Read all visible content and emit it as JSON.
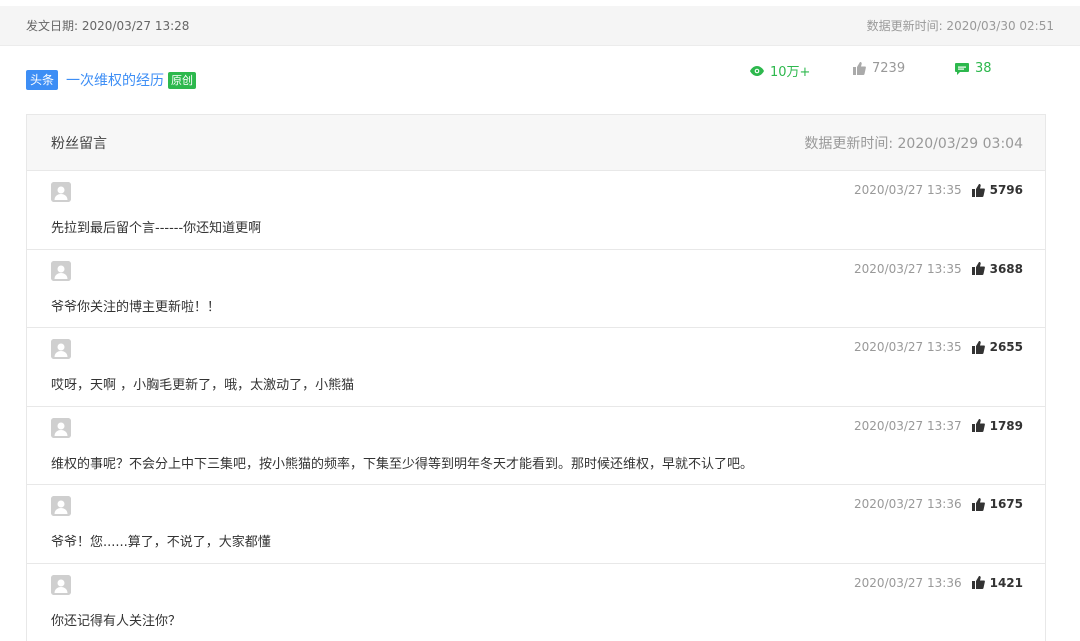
{
  "header": {
    "publish_label": "发文日期: 2020/03/27 13:28",
    "update_label": "数据更新时间: 2020/03/30 02:51"
  },
  "article": {
    "tag": "头条",
    "title": "一次维权的经历",
    "original_badge": "原创",
    "views": "10万+",
    "likes": "7239",
    "comments": "38"
  },
  "comments_panel": {
    "title": "粉丝留言",
    "update_label": "数据更新时间: 2020/03/29 03:04",
    "items": [
      {
        "time": "2020/03/27 13:35",
        "likes": "5796",
        "text": "先拉到最后留个言------你还知道更啊"
      },
      {
        "time": "2020/03/27 13:35",
        "likes": "3688",
        "text": "爷爷你关注的博主更新啦！！"
      },
      {
        "time": "2020/03/27 13:35",
        "likes": "2655",
        "text": "哎呀，天啊 ，小胸毛更新了，哦，太激动了，小熊猫"
      },
      {
        "time": "2020/03/27 13:37",
        "likes": "1789",
        "text": "维权的事呢？不会分上中下三集吧，按小熊猫的频率，下集至少得等到明年冬天才能看到。那时候还维权，早就不认了吧。"
      },
      {
        "time": "2020/03/27 13:36",
        "likes": "1675",
        "text": "爷爷！您......算了，不说了，大家都懂"
      },
      {
        "time": "2020/03/27 13:36",
        "likes": "1421",
        "text": "你还记得有人关注你？"
      }
    ]
  },
  "colors": {
    "accent_blue": "#3d8ef5",
    "accent_green": "#2db84d",
    "muted": "#999999"
  },
  "icons": {
    "views": "eye-icon",
    "likes": "thumbs-up-icon",
    "comments": "comment-bubble-icon",
    "avatar": "user-avatar-icon"
  }
}
